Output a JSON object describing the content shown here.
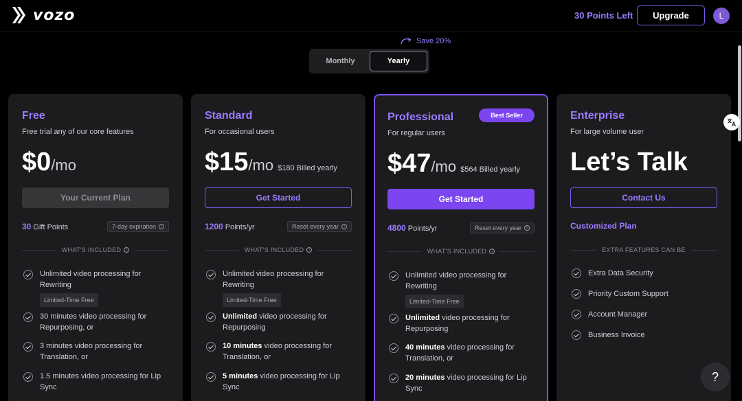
{
  "header": {
    "logo_text": "vozo",
    "points_left": "30 Points Left",
    "upgrade_label": "Upgrade",
    "avatar_initial": "L"
  },
  "billing": {
    "save_label": "Save 20%",
    "monthly_label": "Monthly",
    "yearly_label": "Yearly",
    "selected": "Yearly"
  },
  "plans": [
    {
      "name": "Free",
      "desc": "Free trial any of our core features",
      "price": "$0",
      "unit": "/mo",
      "note": "",
      "button": "Your Current Plan",
      "points_num": "30",
      "points_label": " Gift Points",
      "pill": "7-day expiration",
      "included_label": "WHAT'S INCLUDED",
      "features": [
        {
          "bold": "",
          "text": "Unlimited video processing for Rewriting",
          "tag": "Limited-Time Free"
        },
        {
          "bold": "",
          "text": "30 minutes video processing for Repurposing, or"
        },
        {
          "bold": "",
          "text": "3 minutes video processing for Translation, or"
        },
        {
          "bold": "",
          "text": "1.5 minutes video processing for Lip Sync"
        }
      ]
    },
    {
      "name": "Standard",
      "desc": "For occasional users",
      "price": "$15",
      "unit": "/mo",
      "note": "$180 Billed yearly",
      "button": "Get Started",
      "points_num": "1200",
      "points_label": " Points/yr",
      "pill": "Reset every year",
      "included_label": "WHAT'S INCLUDED",
      "features": [
        {
          "bold": "",
          "text": "Unlimited video processing for Rewriting",
          "tag": "Limited-Time Free"
        },
        {
          "bold": "Unlimited",
          "text": " video processing for Repurposing"
        },
        {
          "bold": "10 minutes",
          "text": " video processing for Translation, or"
        },
        {
          "bold": "5 minutes",
          "text": " video processing for Lip Sync"
        }
      ]
    },
    {
      "name": "Professional",
      "badge": "Best Seller",
      "desc": "For regular users",
      "price": "$47",
      "unit": "/mo",
      "note": "$564 Billed yearly",
      "button": "Get Started",
      "points_num": "4800",
      "points_label": " Points/yr",
      "pill": "Reset every year",
      "included_label": "WHAT'S INCLUDED",
      "features": [
        {
          "bold": "",
          "text": "Unlimited video processing for Rewriting",
          "tag": "Limited-Time Free"
        },
        {
          "bold": "Unlimited",
          "text": " video processing for Repurposing"
        },
        {
          "bold": "40 minutes",
          "text": " video processing for Translation, or"
        },
        {
          "bold": "20 minutes",
          "text": " video processing for Lip Sync"
        }
      ]
    },
    {
      "name": "Enterprise",
      "desc": "For large volume user",
      "talk": "Let’s Talk",
      "button": "Contact Us",
      "custom_plan": "Customized Plan",
      "extra_label": "EXTRA FEATURES CAN BE",
      "extras": [
        "Extra Data Security",
        "Priority Custom Support",
        "Account Manager",
        "Business Invoice"
      ]
    }
  ],
  "help_label": "?",
  "colors": {
    "accent": "#7b45f0",
    "accent_text": "#9b7bff",
    "card_bg": "#1c1c1f",
    "page_bg": "#000000"
  }
}
